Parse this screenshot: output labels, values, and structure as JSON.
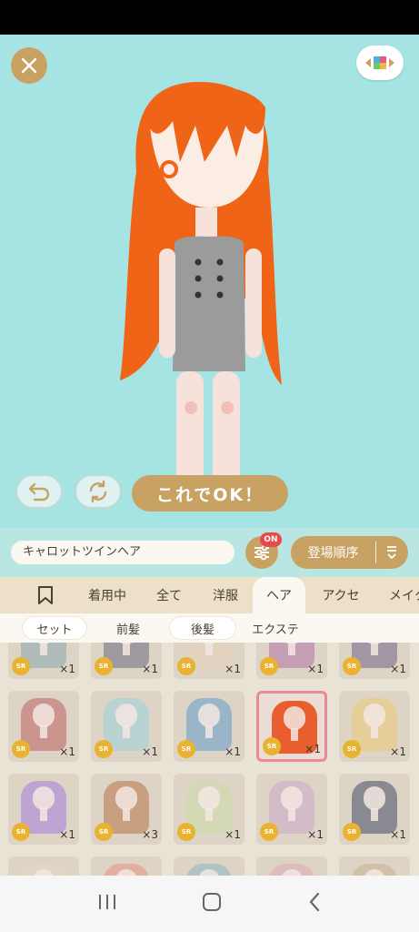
{
  "confirm_label": "これでOK！",
  "item_name": "キャロットツインヘア",
  "filter_badge": "ON",
  "sort_label": "登場順序",
  "tabs": [
    "着用中",
    "全て",
    "洋服",
    "ヘア",
    "アクセ",
    "メイク"
  ],
  "active_tab": "ヘア",
  "subtabs": [
    "セット",
    "前髪",
    "後髪",
    "エクステ"
  ],
  "rarity_label": "SR",
  "items": [
    {
      "count": "×1",
      "hair": "#7aa0a8"
    },
    {
      "count": "×1",
      "hair": "#4f5672"
    },
    {
      "count": "×1",
      "hair": "#e8d0b8"
    },
    {
      "count": "×1",
      "hair": "#a85aa0"
    },
    {
      "count": "×1",
      "hair": "#5c4a7a"
    },
    {
      "count": "×1",
      "hair": "#b8484c"
    },
    {
      "count": "×1",
      "hair": "#8fd0e0"
    },
    {
      "count": "×1",
      "hair": "#4a90c8"
    },
    {
      "count": "×1",
      "hair": "#e8501c",
      "selected": true
    },
    {
      "count": "×1",
      "hair": "#f0c860"
    },
    {
      "count": "×1",
      "hair": "#9a6ae0"
    },
    {
      "count": "×3",
      "hair": "#b0602c"
    },
    {
      "count": "×1",
      "hair": "#c8e0a0"
    },
    {
      "count": "×1",
      "hair": "#c8a0c8"
    },
    {
      "count": "×1",
      "hair": "#243050"
    },
    {
      "count": "",
      "hair": "#e8d8c0"
    },
    {
      "count": "",
      "hair": "#e88070"
    },
    {
      "count": "",
      "hair": "#7ab0c0"
    },
    {
      "count": "",
      "hair": "#e0a0b0"
    },
    {
      "count": "",
      "hair": "#c0a880"
    }
  ],
  "colors": {
    "accent_gold": "#c8a263",
    "stage_bg": "#a5e4e2",
    "badge_red": "#e8494b",
    "sr_gold": "#e9b331"
  }
}
